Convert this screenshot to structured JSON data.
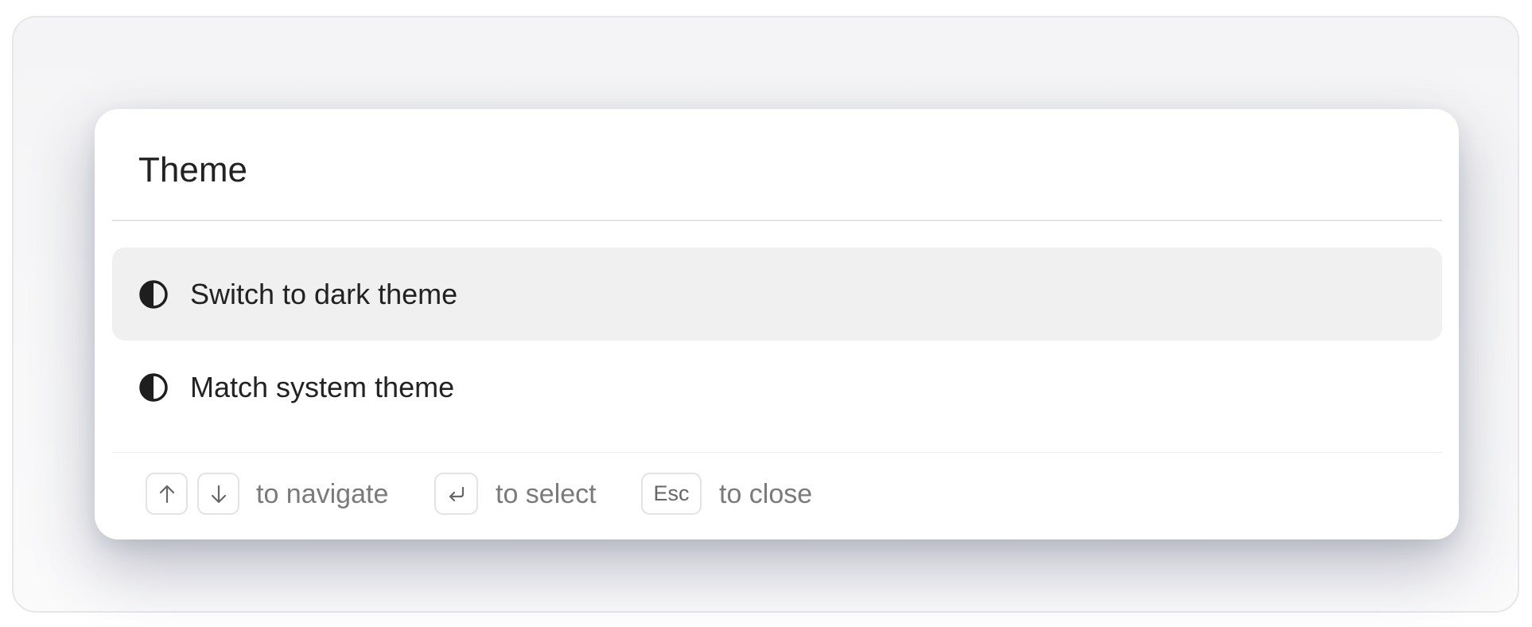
{
  "palette": {
    "title": "Theme",
    "options": [
      {
        "label": "Switch to dark theme",
        "icon": "contrast-icon",
        "selected": true
      },
      {
        "label": "Match system theme",
        "icon": "contrast-icon",
        "selected": false
      }
    ],
    "footer": {
      "navigate_hint": "to navigate",
      "select_hint": "to select",
      "close_hint": "to close",
      "esc_key": "Esc",
      "up_key_icon": "arrow-up-icon",
      "down_key_icon": "arrow-down-icon",
      "enter_key_icon": "enter-icon"
    }
  },
  "colors": {
    "selected_row": "#f0f0f0",
    "text": "#222222",
    "muted_text": "#7a7a7a"
  }
}
